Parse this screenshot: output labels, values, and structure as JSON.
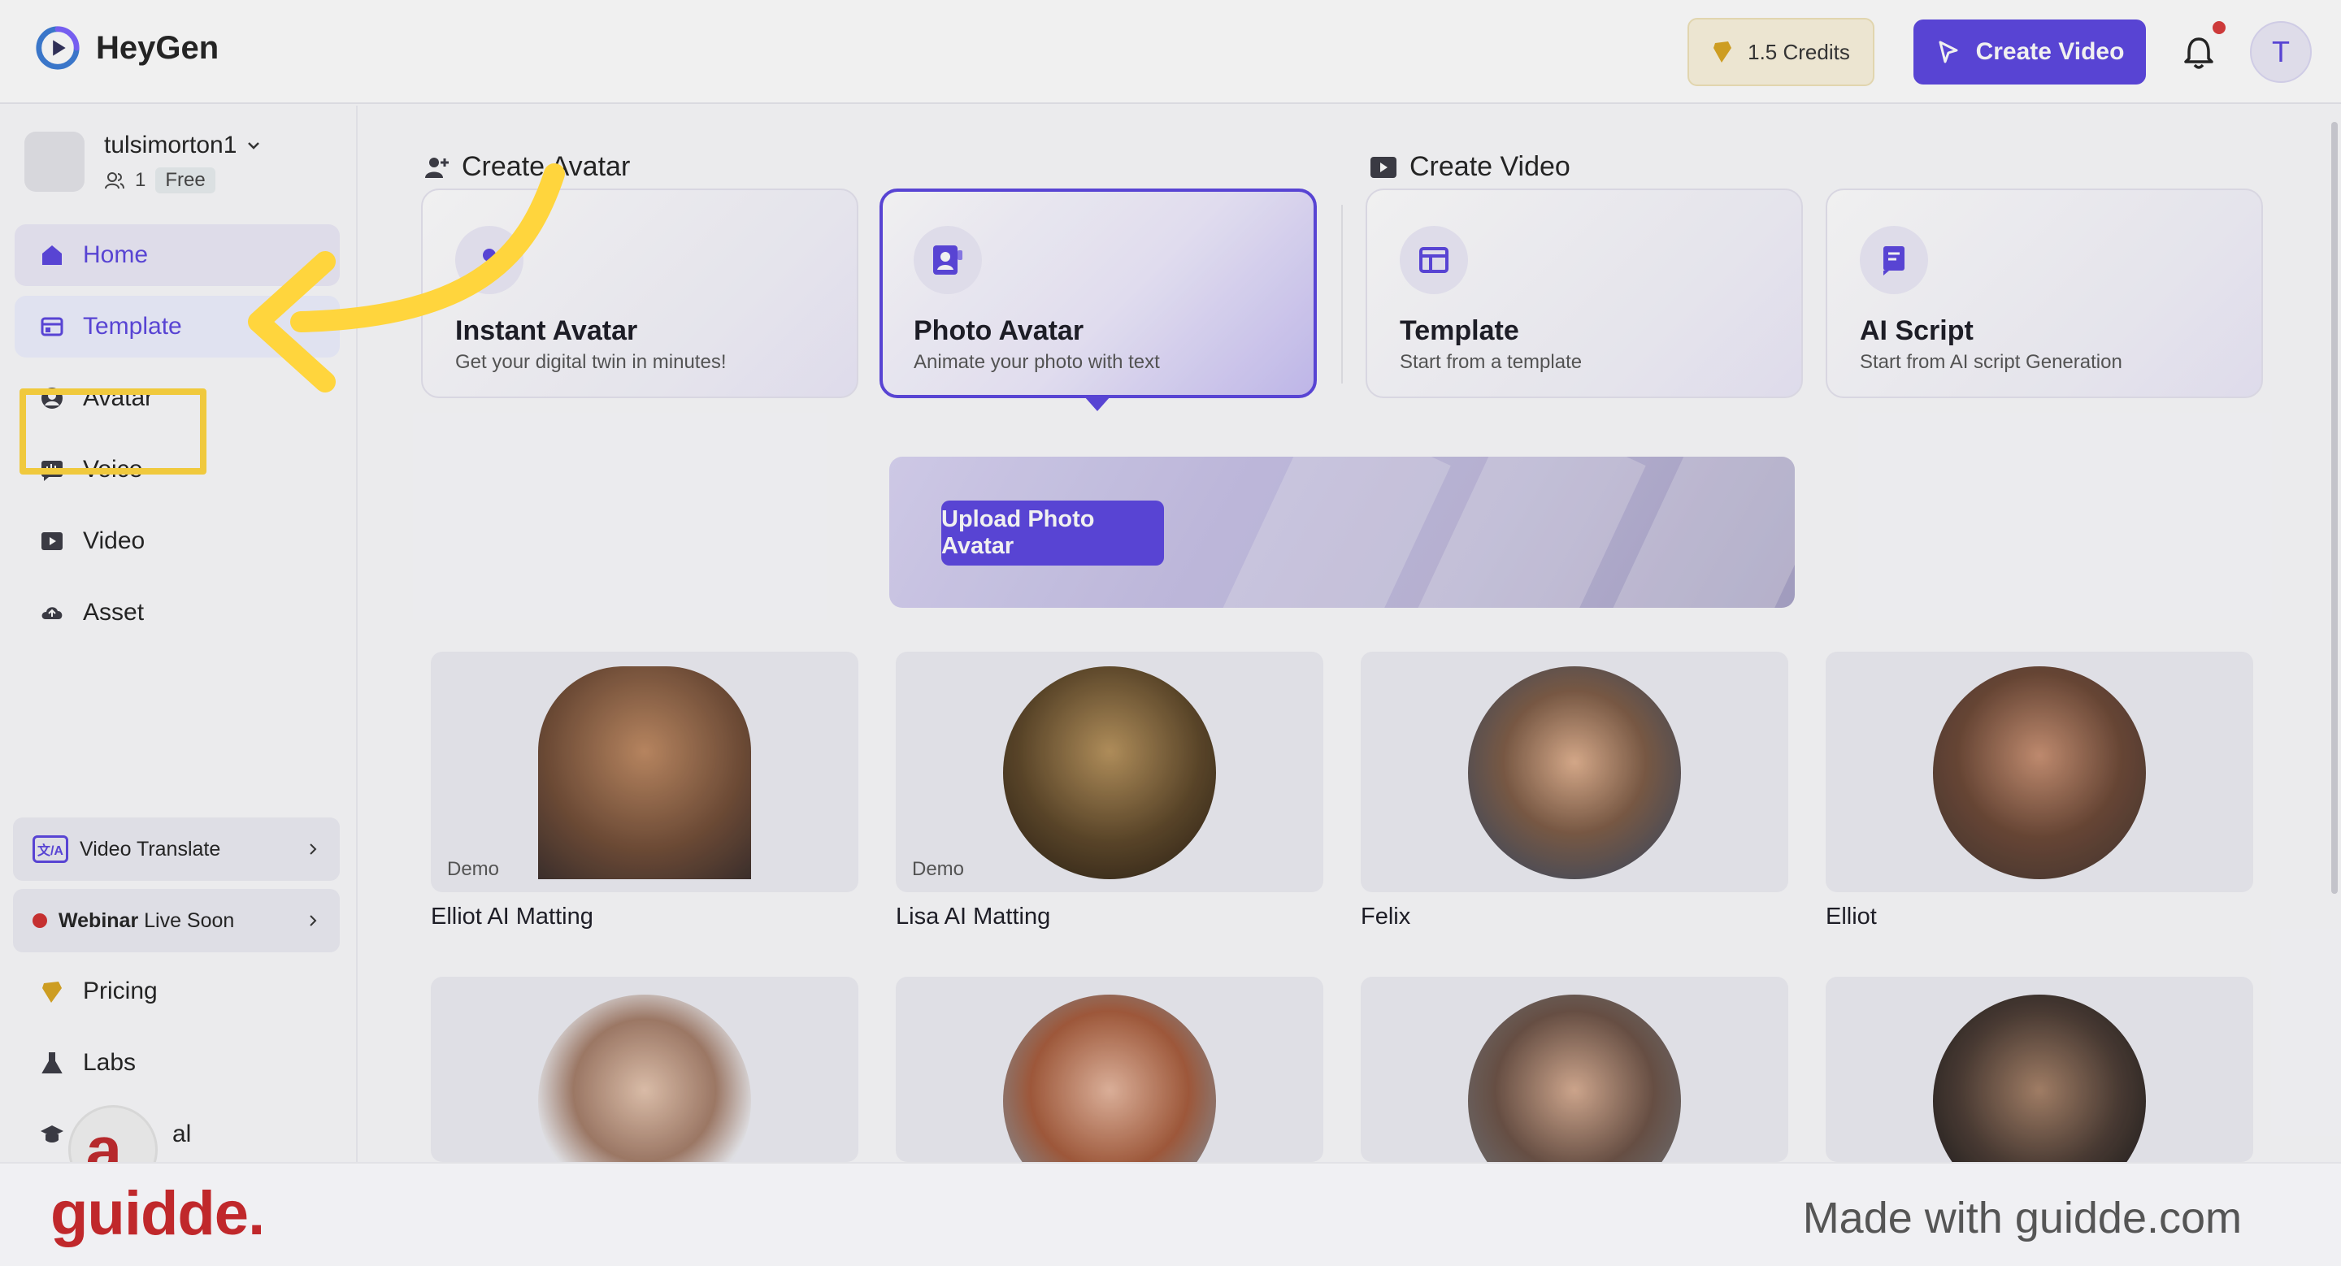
{
  "header": {
    "brand": "HeyGen",
    "credits": "1.5 Credits",
    "create_video": "Create Video",
    "profile_initial": "T"
  },
  "sidebar": {
    "username": "tulsimorton1",
    "members": "1",
    "plan": "Free",
    "nav": [
      {
        "label": "Home",
        "icon": "home-icon"
      },
      {
        "label": "Template",
        "icon": "template-icon"
      },
      {
        "label": "Avatar",
        "icon": "avatar-icon"
      },
      {
        "label": "Voice",
        "icon": "voice-icon"
      },
      {
        "label": "Video",
        "icon": "video-icon"
      },
      {
        "label": "Asset",
        "icon": "asset-icon"
      }
    ],
    "promo_translate": "Video Translate",
    "promo_translate_icon": "文/A",
    "promo_webinar_bold": "Webinar",
    "promo_webinar_rest": " Live Soon",
    "nav_bottom": [
      {
        "label": "Pricing",
        "icon": "pricing-icon"
      },
      {
        "label": "Labs",
        "icon": "labs-icon"
      },
      {
        "label": "al",
        "icon": "tutorial-icon"
      }
    ]
  },
  "main": {
    "create_avatar_title": "Create Avatar",
    "create_video_title": "Create Video",
    "cards": [
      {
        "title": "Instant Avatar",
        "sub": "Get your digital twin in minutes!"
      },
      {
        "title": "Photo Avatar",
        "sub": "Animate your photo with text"
      },
      {
        "title": "Template",
        "sub": "Start from a template"
      },
      {
        "title": "AI Script",
        "sub": "Start from AI script Generation"
      }
    ],
    "upload_button": "Upload Photo Avatar",
    "avatars": [
      {
        "name": "Elliot AI Matting",
        "tag": "Demo"
      },
      {
        "name": "Lisa AI Matting",
        "tag": "Demo"
      },
      {
        "name": "Felix",
        "tag": ""
      },
      {
        "name": "Elliot",
        "tag": ""
      }
    ]
  },
  "footer": {
    "logo": "guidde.",
    "made_with": "Made with guidde.com",
    "circle_logo": "a."
  },
  "colors": {
    "accent": "#5b45e0",
    "highlight": "#ffd53d",
    "guidde_red": "#c0282b"
  }
}
